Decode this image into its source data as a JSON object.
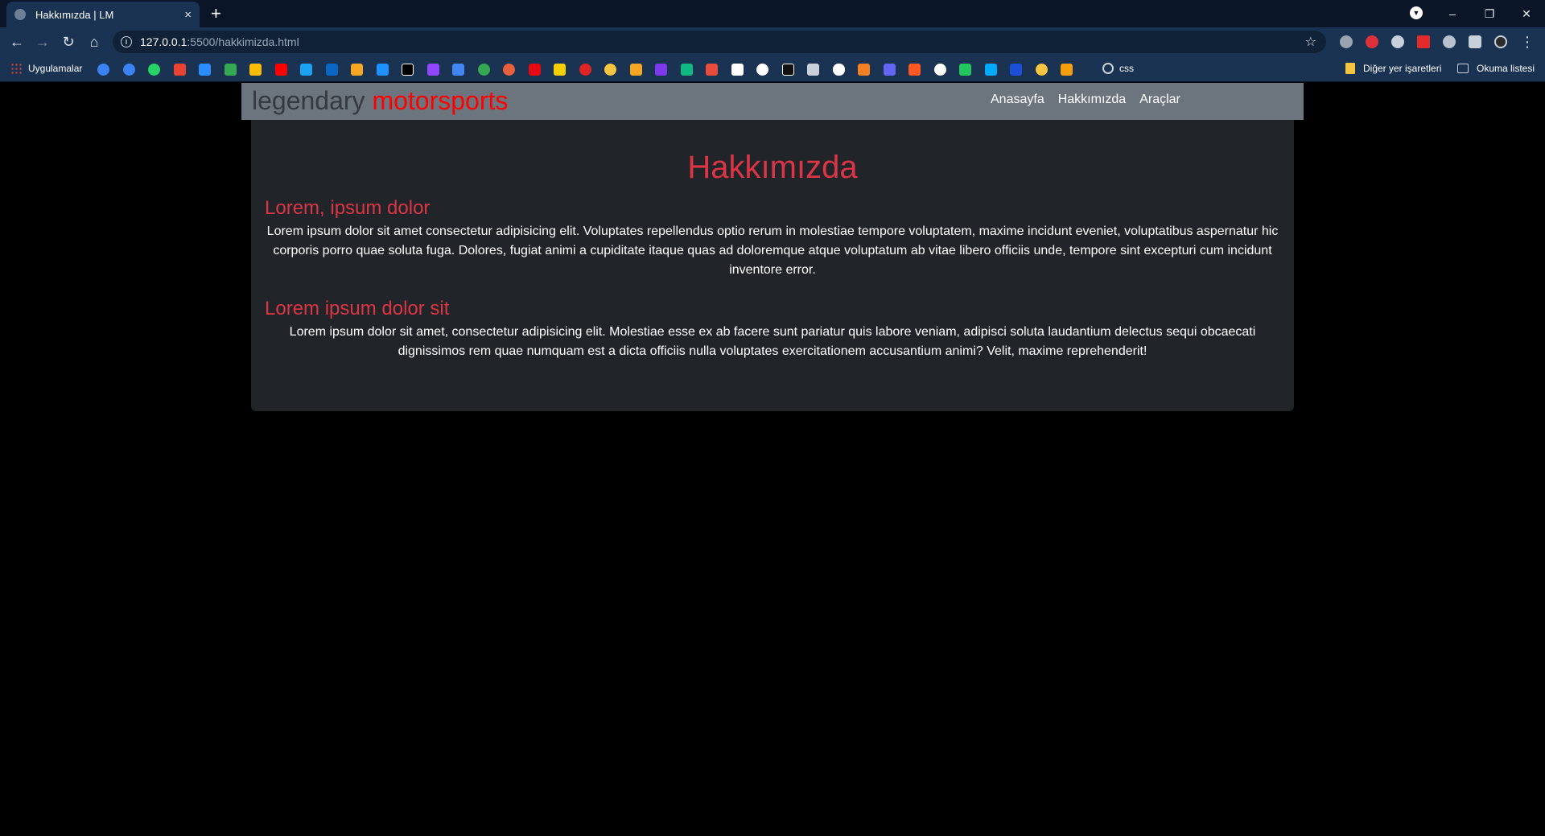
{
  "browser": {
    "tab_title": "Hakkımızda | LM",
    "new_tab_label": "+",
    "tab_close_label": "×",
    "url_host": "127.0.0.1",
    "url_path": ":5500/hakkimizda.html",
    "window_controls": {
      "minimize": "–",
      "restore": "❐",
      "close": "✕"
    },
    "bookmarks": {
      "apps_label": "Uygulamalar",
      "css_label": "css",
      "other_label": "Diğer yer işaretleri",
      "reading_list_label": "Okuma listesi"
    }
  },
  "site": {
    "brand_part1": "legendary",
    "brand_part2": "motorsports",
    "nav": [
      "Anasayfa",
      "Hakkımızda",
      "Araçlar"
    ]
  },
  "content": {
    "title": "Hakkımızda",
    "sections": [
      {
        "heading": "Lorem, ipsum dolor",
        "text": "Lorem ipsum dolor sit amet consectetur adipisicing elit. Voluptates repellendus optio rerum in molestiae tempore voluptatem, maxime incidunt eveniet, voluptatibus aspernatur hic corporis porro quae soluta fuga. Dolores, fugiat animi a cupiditate itaque quas ad doloremque atque voluptatum ab vitae libero officiis unde, tempore sint excepturi cum incidunt inventore error."
      },
      {
        "heading": "Lorem ipsum dolor sit",
        "text": "Lorem ipsum dolor sit amet, consectetur adipisicing elit. Molestiae esse ex ab facere sunt pariatur quis labore veniam, adipisci soluta laudantium delectus sequi obcaecati dignissimos rem quae numquam est a dicta officiis nulla voluptates exercitationem accusantium animi? Velit, maxime reprehenderit!"
      }
    ]
  },
  "colors": {
    "accent_red": "#dc3545",
    "brand_red": "#ff0000",
    "site_nav_bg": "#6c757d",
    "card_bg": "#212529"
  }
}
